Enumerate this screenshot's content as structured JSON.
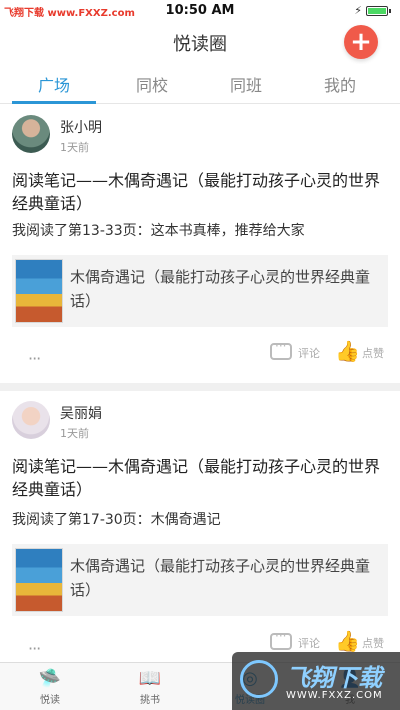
{
  "status_bar": {
    "carrier": "飞翔下载 www.FXXZ.com",
    "time": "10:50 AM",
    "battery_level": 1.0
  },
  "nav": {
    "title": "悦读圈",
    "add_icon": "plus-icon"
  },
  "tabs": [
    {
      "label": "广场",
      "active": true
    },
    {
      "label": "同校",
      "active": false
    },
    {
      "label": "同班",
      "active": false
    },
    {
      "label": "我的",
      "active": false
    }
  ],
  "posts": [
    {
      "username": "张小明",
      "time_ago": "1天前",
      "title": "阅读笔记——木偶奇遇记（最能打动孩子心灵的世界经典童话）",
      "body": "我阅读了第13-33页：这本书真棒，推荐给大家",
      "book_title": "木偶奇遇记（最能打动孩子心灵的世界经典童话）",
      "comment_label": "评论",
      "like_label": "点赞",
      "more_label": "···"
    },
    {
      "username": "吴丽娟",
      "time_ago": "1天前",
      "title": "阅读笔记——木偶奇遇记（最能打动孩子心灵的世界经典童话）",
      "body": "我阅读了第17-30页：木偶奇遇记",
      "book_title": "木偶奇遇记（最能打动孩子心灵的世界经典童话）",
      "comment_label": "评论",
      "like_label": "点赞",
      "more_label": "···"
    }
  ],
  "tab_bar": [
    {
      "label": "悦读",
      "icon": "ufo-icon",
      "active": false
    },
    {
      "label": "挑书",
      "icon": "book-icon",
      "active": false
    },
    {
      "label": "悦读圈",
      "icon": "circle-icon",
      "active": true
    },
    {
      "label": "我",
      "icon": "user-icon",
      "active": false
    }
  ],
  "watermark": {
    "text": "飞翔下载",
    "url": "WWW.FXXZ.COM"
  },
  "colors": {
    "accent": "#2b96d6",
    "add_button": "#f05a4a"
  }
}
